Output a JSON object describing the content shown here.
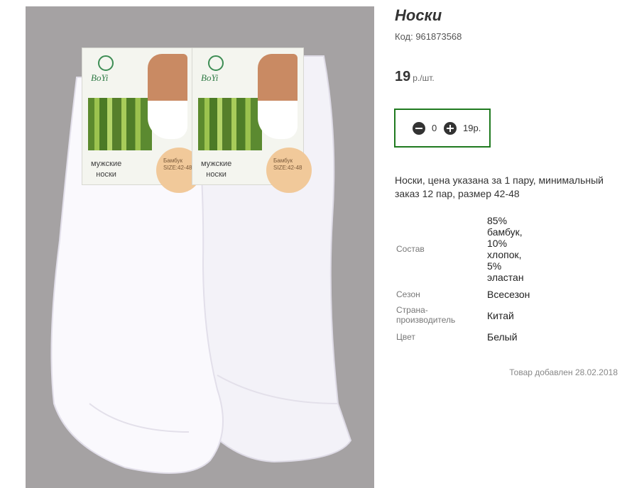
{
  "product": {
    "title": "Носки",
    "code": "Код: 961873568",
    "price_value": "19",
    "price_unit": "р./шт."
  },
  "quantity": {
    "count": "0",
    "total": "19р.",
    "border_color": "#1f7a1f"
  },
  "description": "Носки, цена указана за 1 пару, минимальный заказ 12 пар, размер 42-48",
  "properties": [
    {
      "label": "Состав",
      "value": "85% бамбук, 10% хлопок, 5% эластан"
    },
    {
      "label": "Сезон",
      "value": "Всесезон"
    },
    {
      "label": "Страна-производитель",
      "value": "Китай"
    },
    {
      "label": "Цвет",
      "value": "Белый"
    }
  ],
  "added_date": "Товар добавлен 28.02.2018",
  "photo": {
    "brand": "BoYi",
    "card_line1": "мужские",
    "card_line2": "носки",
    "card_tag": "Бамбук",
    "card_size": "SIZE:42-48"
  }
}
